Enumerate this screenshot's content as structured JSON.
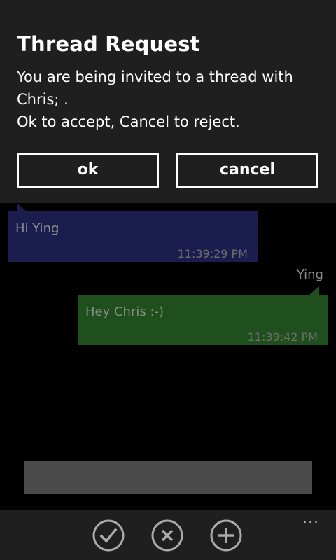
{
  "dialog": {
    "title": "Thread Request",
    "message_line1": "You are being invited to a thread with",
    "message_line2": "Chris; .",
    "message_line3": "Ok to accept, Cancel to reject.",
    "ok_label": "ok",
    "cancel_label": "cancel"
  },
  "conversation": {
    "messages": [
      {
        "text": "Hi Ying",
        "time": "11:39:29 PM",
        "direction": "incoming"
      },
      {
        "sender": "Ying",
        "text": "Hey Chris :-)",
        "time": "11:39:42 PM",
        "direction": "outgoing"
      }
    ]
  },
  "input": {
    "value": ""
  },
  "app_bar": {
    "icons": [
      "check-icon",
      "close-icon",
      "add-icon"
    ],
    "more_label": "..."
  },
  "colors": {
    "incoming_bubble": "#1c1d4f",
    "outgoing_bubble": "#1f4f1d",
    "dialog_background": "#1f1f1f",
    "input_background": "#4a4a4a"
  }
}
